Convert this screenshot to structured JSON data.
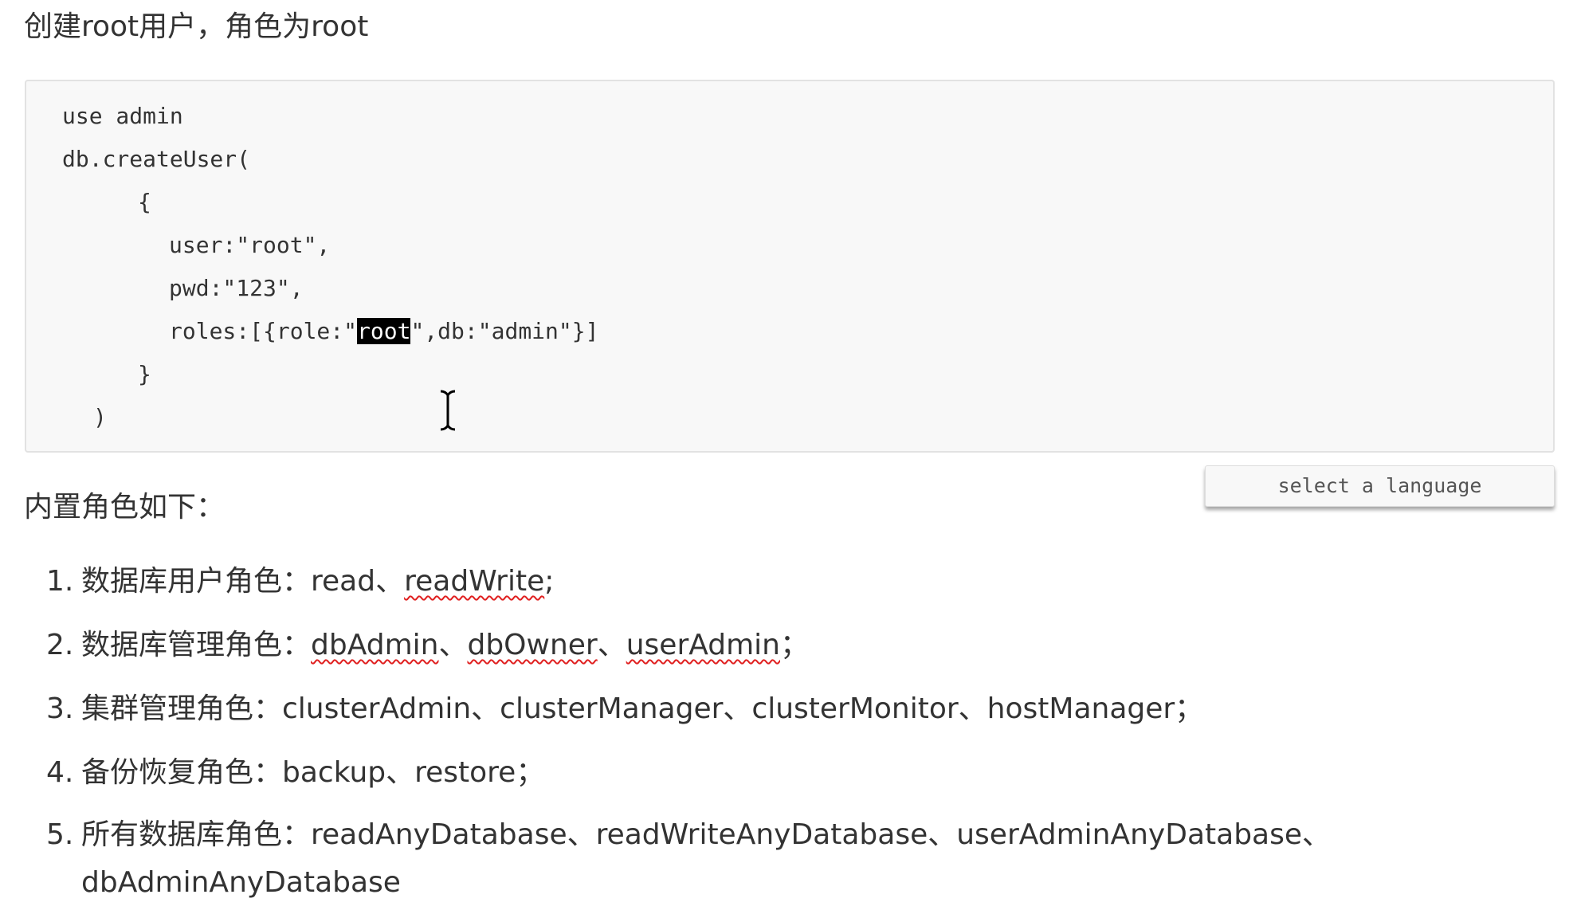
{
  "heading": "创建root用户，角色为root",
  "code": {
    "line1": "use admin",
    "line2": "db.createUser(",
    "line3": "{",
    "line4": "user:\"root\",",
    "line5": "pwd:\"123\",",
    "line6_pre": "roles:[{role:\"",
    "line6_sel": "root",
    "line6_post": "\",db:\"admin\"}]",
    "line7": "}",
    "line8": ")"
  },
  "language_select": {
    "label": "select a language"
  },
  "subheading": "内置角色如下：",
  "list": {
    "item1": {
      "num": "1.",
      "prefix": "数据库用户角色：",
      "t1": "read",
      "sep1": "、",
      "t2": "readWrite",
      "end": ";"
    },
    "item2": {
      "num": "2.",
      "prefix": "数据库管理角色：",
      "t1": "dbAdmin",
      "sep1": "、",
      "t2": "dbOwner",
      "sep2": "、",
      "t3": "userAdmin",
      "end": "；"
    },
    "item3": {
      "num": "3.",
      "text": "集群管理角色：clusterAdmin、clusterManager、clusterMonitor、hostManager；"
    },
    "item4": {
      "num": "4.",
      "text": "备份恢复角色：backup、restore；"
    },
    "item5": {
      "num": "5.",
      "text": "所有数据库角色：readAnyDatabase、readWriteAnyDatabase、userAdminAnyDatabase、",
      "cont": "dbAdminAnyDatabase"
    }
  }
}
